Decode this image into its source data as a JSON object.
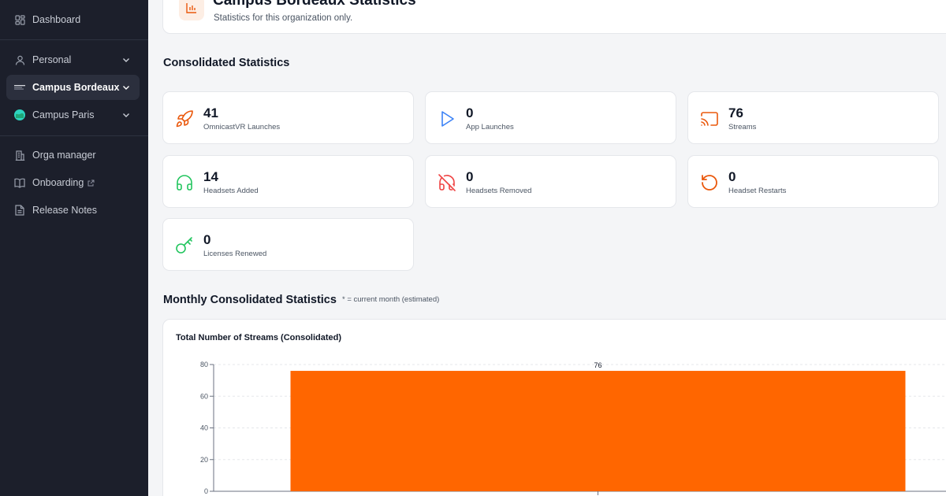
{
  "sidebar": {
    "items": [
      {
        "label": "Dashboard",
        "icon": "grid-icon"
      },
      {
        "label": "Personal",
        "icon": "user-icon"
      },
      {
        "label": "Campus Bordeaux",
        "icon": "omnicast-logo-icon"
      },
      {
        "label": "Campus Paris",
        "icon": "globe-avatar-icon"
      },
      {
        "label": "Orga manager",
        "icon": "building-icon"
      },
      {
        "label": "Onboarding",
        "icon": "book-icon"
      },
      {
        "label": "Release Notes",
        "icon": "file-text-icon"
      }
    ]
  },
  "header": {
    "title": "Campus Bordeaux Statistics",
    "subtitle": "Statistics for this organization only."
  },
  "consolidated": {
    "title": "Consolidated Statistics",
    "stats": [
      {
        "value": "41",
        "label": "OmnicastVR Launches",
        "icon": "rocket-icon",
        "color": "#ea580c"
      },
      {
        "value": "0",
        "label": "App Launches",
        "icon": "play-icon",
        "color": "#3b82f6"
      },
      {
        "value": "76",
        "label": "Streams",
        "icon": "cast-icon",
        "color": "#ea580c"
      },
      {
        "value": "14",
        "label": "Headsets Added",
        "icon": "headphones-icon",
        "color": "#22c55e"
      },
      {
        "value": "0",
        "label": "Headsets Removed",
        "icon": "headphones-off-icon",
        "color": "#ef4444"
      },
      {
        "value": "0",
        "label": "Headset Restarts",
        "icon": "rotate-ccw-icon",
        "color": "#ea580c"
      },
      {
        "value": "0",
        "label": "Licenses Renewed",
        "icon": "key-icon",
        "color": "#22c55e"
      }
    ]
  },
  "monthly": {
    "title": "Monthly Consolidated Statistics",
    "note": "* = current month (estimated)"
  },
  "chart_data": {
    "type": "bar",
    "title": "Total Number of Streams (Consolidated)",
    "categories": [
      ""
    ],
    "values": [
      76
    ],
    "ylim": [
      0,
      80
    ],
    "yticks": [
      0,
      20,
      40,
      60,
      80
    ],
    "grid": true,
    "bar_color": "#ff6600"
  }
}
